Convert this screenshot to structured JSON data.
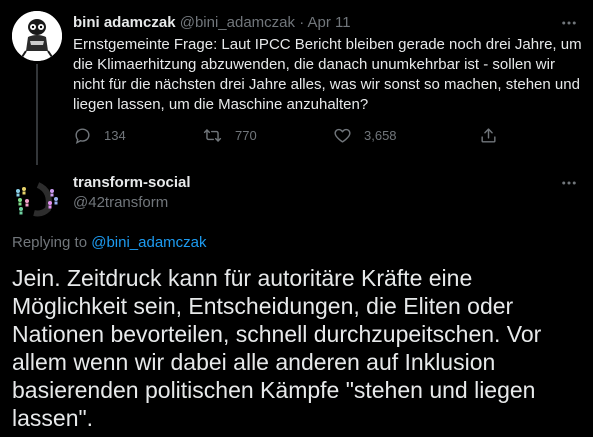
{
  "colors": {
    "background": "#000000",
    "text_primary": "#e7e9ea",
    "text_secondary": "#71767b",
    "link": "#1d9bf0",
    "divider": "#333639"
  },
  "parent_tweet": {
    "display_name": "bini adamczak",
    "handle": "@bini_adamczak",
    "separator": "·",
    "date": "Apr 11",
    "text": "Ernstgemeinte Frage: Laut IPCC Bericht bleiben gerade noch drei Jahre, um die Klimaerhitzung abzuwenden, die danach unumkehrbar ist - sollen wir nicht für die nächsten drei Jahre alles, was wir sonst so machen, stehen und liegen lassen, um die Maschine anzuhalten?",
    "actions": {
      "reply": {
        "icon": "reply-icon",
        "count": "134"
      },
      "retweet": {
        "icon": "retweet-icon",
        "count": "770"
      },
      "like": {
        "icon": "heart-icon",
        "count": "3,658"
      },
      "share": {
        "icon": "share-icon"
      }
    }
  },
  "reply_tweet": {
    "display_name": "transform-social",
    "handle": "@42transform",
    "replying_to_label": "Replying to",
    "replying_to_handle": "@bini_adamczak",
    "text": "Jein. Zeitdruck kann für autoritäre Kräfte eine Möglichkeit sein, Entscheidungen, die Eliten oder Nationen bevorteilen, schnell durchzupeitschen. Vor allem wenn wir dabei alle anderen auf Inklusion basierenden politischen Kämpfe \"stehen und liegen lassen\"."
  }
}
